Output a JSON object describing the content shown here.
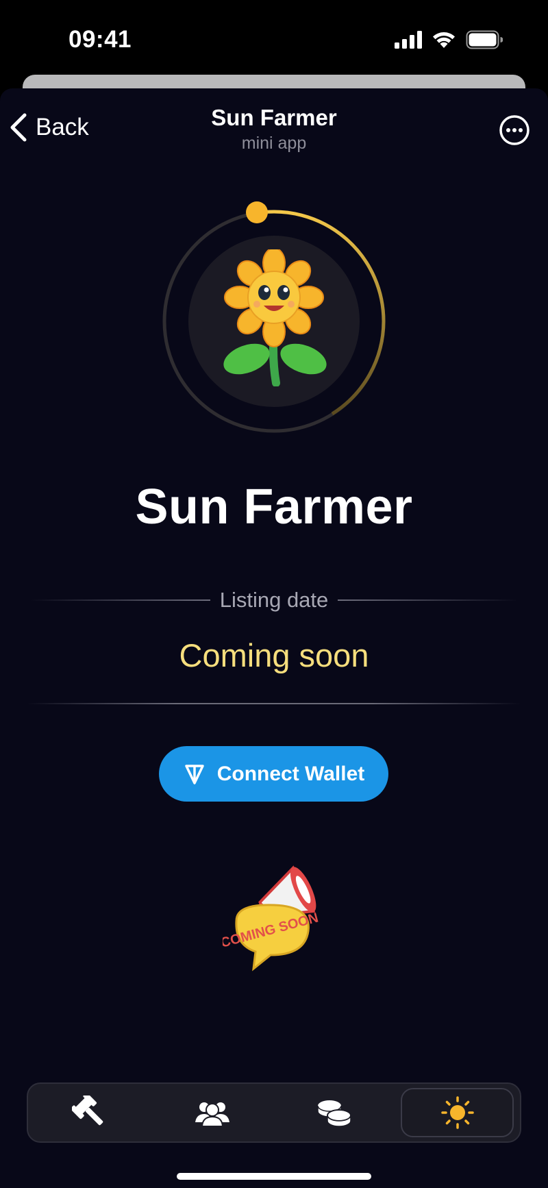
{
  "status_bar": {
    "time": "09:41"
  },
  "nav": {
    "back_label": "Back",
    "title": "Sun Farmer",
    "subtitle": "mini app"
  },
  "app": {
    "name": "Sun Farmer",
    "listing_label": "Listing date",
    "listing_value": "Coming soon",
    "connect_wallet_label": "Connect Wallet",
    "sticker_text": "COMING SOON"
  },
  "tabs": [
    {
      "icon": "gavel-icon",
      "active": false
    },
    {
      "icon": "friends-icon",
      "active": false
    },
    {
      "icon": "coins-icon",
      "active": false
    },
    {
      "icon": "sun-icon",
      "active": true
    }
  ],
  "colors": {
    "background": "#080818",
    "accent_blue": "#1b95e6",
    "accent_gold": "#f6de7d",
    "sun_orange": "#f7b52c"
  }
}
